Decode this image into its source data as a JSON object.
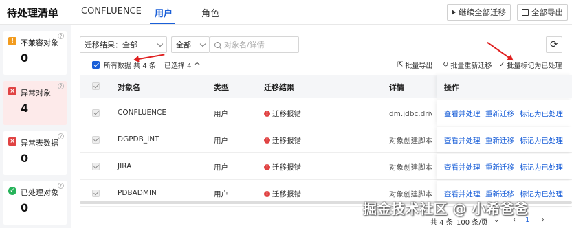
{
  "header": {
    "title": "待处理清单",
    "tabs": [
      {
        "label": "CONFLUENCE",
        "active": false
      },
      {
        "label": "用户",
        "active": true
      },
      {
        "label": "角色",
        "active": false
      }
    ],
    "continue_button": "继续全部迁移",
    "export_all_button": "全部导出"
  },
  "sidebar": {
    "cards": [
      {
        "label": "不兼容对象",
        "count": "0",
        "icon": "warning-icon",
        "color": "#f29c1f"
      },
      {
        "label": "异常对象",
        "count": "4",
        "icon": "error-icon",
        "color": "#e04343"
      },
      {
        "label": "异常表数据",
        "count": "0",
        "icon": "error-icon",
        "color": "#e04343"
      },
      {
        "label": "已处理对象",
        "count": "0",
        "icon": "check-icon",
        "color": "#27b35a"
      }
    ]
  },
  "filters": {
    "result_select": "迁移结果：全部",
    "scope_select": "全部",
    "search_placeholder": "对象名/详情"
  },
  "selection": {
    "all_data_label": "所有数据 共 4 条",
    "selected_label": "已选择 4 个"
  },
  "batch_actions": {
    "export": "批量导出",
    "retry": "批量重新迁移",
    "mark": "批量标记为已处理"
  },
  "table": {
    "columns": [
      "对象名",
      "类型",
      "迁移结果",
      "详情",
      "操作"
    ],
    "rows": [
      {
        "name": "CONFLUENCE",
        "type": "用户",
        "result": "迁移报错",
        "detail": "dm.jdbc.driv 附近出现错误",
        "ops": [
          "查看并处理",
          "重新迁移",
          "标记为已处理"
        ]
      },
      {
        "name": "DGPDB_INT",
        "type": "用户",
        "result": "迁移报错",
        "detail": "对象创建脚本",
        "ops": [
          "查看并处理",
          "重新迁移",
          "标记为已处理"
        ]
      },
      {
        "name": "JIRA",
        "type": "用户",
        "result": "迁移报错",
        "detail": "对象创建脚本",
        "ops": [
          "查看并处理",
          "重新迁移",
          "标记为已处理"
        ]
      },
      {
        "name": "PDBADMIN",
        "type": "用户",
        "result": "迁移报错",
        "detail": "对象创建脚本",
        "ops": [
          "查看并处理",
          "重新迁移",
          "标记为已处理"
        ]
      }
    ]
  },
  "footer": {
    "total": "共 4 条",
    "page_size": "100 条/页",
    "page": "1"
  },
  "watermark": "掘金技术社区 @ 小希爸爸",
  "colors": {
    "accent": "#1a5fd8",
    "error": "#e04343",
    "annotation": "#e02020"
  }
}
